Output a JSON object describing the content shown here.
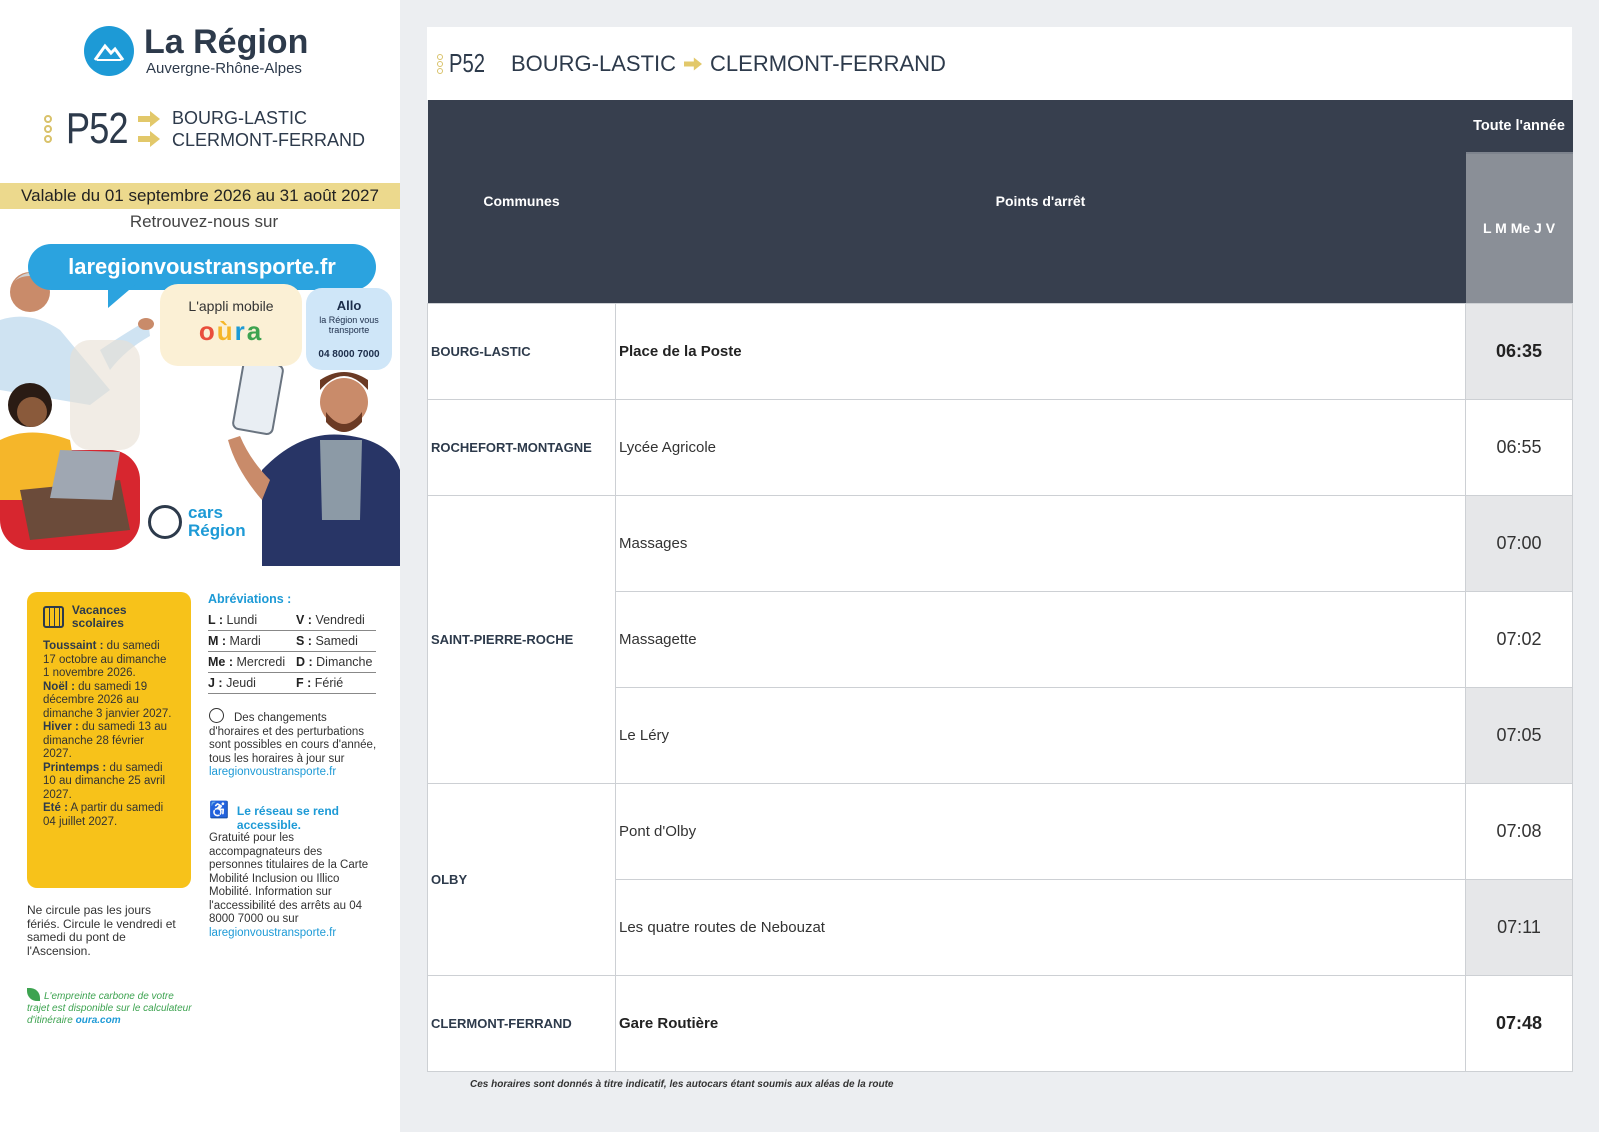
{
  "brand": {
    "title": "La Région",
    "subtitle": "Auvergne-Rhône-Alpes"
  },
  "line": {
    "number": "P52",
    "destination_1": "BOURG-LASTIC",
    "destination_2": "CLERMONT-FERRAND",
    "accent_color": "#d9c26a"
  },
  "validity": "Valable du 01 septembre 2026 au 31 août 2027",
  "find_us": "Retrouvez-nous sur",
  "promo": {
    "website": "laregionvoustransporte.fr",
    "app_label": "L'appli mobile",
    "app_name": "oùra",
    "allo_title": "Allo",
    "allo_sub": "la Région vous transporte",
    "allo_phone": "04 8000 7000",
    "cars_line1": "cars",
    "cars_line2": "Région"
  },
  "holidays": {
    "title": "Vacances scolaires",
    "items": [
      {
        "label": "Toussaint :",
        "text": " du samedi 17 octobre au dimanche 1 novembre 2026."
      },
      {
        "label": "Noël :",
        "text": " du samedi 19 décembre 2026 au dimanche 3 janvier 2027."
      },
      {
        "label": "Hiver :",
        "text": " du samedi 13 au dimanche 28 février 2027."
      },
      {
        "label": "Printemps :",
        "text": " du samedi 10 au dimanche 25 avril 2027."
      },
      {
        "label": "Eté :",
        "text": " A partir du samedi 04 juillet 2027."
      }
    ]
  },
  "abbreviations": {
    "title": "Abréviations :",
    "rows": [
      [
        {
          "k": "L :",
          "v": " Lundi"
        },
        {
          "k": "V :",
          "v": " Vendredi"
        }
      ],
      [
        {
          "k": "M :",
          "v": " Mardi"
        },
        {
          "k": "S :",
          "v": " Samedi"
        }
      ],
      [
        {
          "k": "Me :",
          "v": " Mercredi"
        },
        {
          "k": "D :",
          "v": " Dimanche"
        }
      ],
      [
        {
          "k": "J :",
          "v": " Jeudi"
        },
        {
          "k": "F :",
          "v": " Férié"
        }
      ]
    ]
  },
  "changes_note": {
    "text": "Des changements d'horaires et des perturbations sont possibles en cours d'année, tous les horaires à jour sur",
    "link": "laregionvoustransporte.fr"
  },
  "accessibility": {
    "title": "Le réseau se rend accessible.",
    "text": "Gratuité pour les accompagnateurs des personnes titulaires de la Carte Mobilité Inclusion ou Illico Mobilité. Information sur l'accessibilité des arrêts au 04 8000 7000 ou sur",
    "link": "laregionvoustransporte.fr"
  },
  "circulation_note": "Ne circule pas les jours fériés. Circule le vendredi et samedi du pont de l'Ascension.",
  "carbon_note": {
    "text": "L'empreinte carbone de votre trajet est disponible sur le calculateur d'itinéraire",
    "link": "oura.com"
  },
  "timetable": {
    "header_line": "P52",
    "from": "BOURG-LASTIC",
    "to": "CLERMONT-FERRAND",
    "col_communes": "Communes",
    "col_stops": "Points d'arrêt",
    "period": "Toute l'année",
    "days": "L M Me J V",
    "rows": [
      {
        "commune": "BOURG-LASTIC",
        "stop": "Place de la Poste",
        "time": "06:35",
        "bold": true
      },
      {
        "commune": "ROCHEFORT-MONTAGNE",
        "stop": "Lycée Agricole",
        "time": "06:55",
        "bold": false
      },
      {
        "commune": "SAINT-PIERRE-ROCHE",
        "stop": "Massages",
        "time": "07:00",
        "bold": false
      },
      {
        "commune": "",
        "stop": "Massagette",
        "time": "07:02",
        "bold": false
      },
      {
        "commune": "",
        "stop": "Le Léry",
        "time": "07:05",
        "bold": false
      },
      {
        "commune": "OLBY",
        "stop": "Pont d'Olby",
        "time": "07:08",
        "bold": false
      },
      {
        "commune": "",
        "stop": "Les quatre routes de Nebouzat",
        "time": "07:11",
        "bold": false
      },
      {
        "commune": "CLERMONT-FERRAND",
        "stop": "Gare Routière",
        "time": "07:48",
        "bold": true
      }
    ],
    "disclaimer": "Ces horaires sont donnés à titre indicatif, les autocars étant soumis aux aléas de la route"
  }
}
